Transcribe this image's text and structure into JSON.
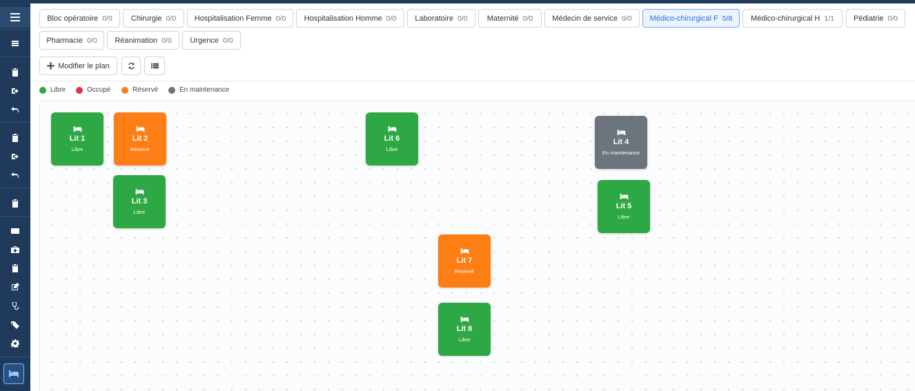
{
  "tabs": [
    {
      "label": "Bloc opératoire",
      "count": "0/0"
    },
    {
      "label": "Chirurgie",
      "count": "0/0"
    },
    {
      "label": "Hospitalisation Femme",
      "count": "0/0"
    },
    {
      "label": "Hospitalisation Homme",
      "count": "0/0"
    },
    {
      "label": "Laboratoire",
      "count": "0/0"
    },
    {
      "label": "Maternité",
      "count": "0/0"
    },
    {
      "label": "Médecin de service",
      "count": "0/0"
    },
    {
      "label": "Médico-chirurgical F",
      "count": "5/8",
      "active": true
    },
    {
      "label": "Médico-chirurgical H",
      "count": "1/1"
    },
    {
      "label": "Pédiatrie",
      "count": "0/0"
    },
    {
      "label": "Pharmacie",
      "count": "0/0"
    },
    {
      "label": "Réanimation",
      "count": "0/0"
    },
    {
      "label": "Urgence",
      "count": "0/0"
    }
  ],
  "toolbar": {
    "edit_plan_label": "Modifier le plan",
    "edit_plan_icon": "move-icon",
    "refresh_icon": "refresh-icon",
    "list_icon": "list-icon"
  },
  "legend": [
    {
      "label": "Libre",
      "color": "#2ea844"
    },
    {
      "label": "Occupé",
      "color": "#dc3545"
    },
    {
      "label": "Réservé",
      "color": "#fd7e14"
    },
    {
      "label": "En maintenance",
      "color": "#6c757d"
    }
  ],
  "beds": [
    {
      "name": "Lit 1",
      "status": "Libre"
    },
    {
      "name": "Lit 2",
      "status": "Réservé"
    },
    {
      "name": "Lit 3",
      "status": "Libre"
    },
    {
      "name": "Lit 6",
      "status": "Libre"
    },
    {
      "name": "Lit 4",
      "status": "En maintenance"
    },
    {
      "name": "Lit 5",
      "status": "Libre"
    },
    {
      "name": "Lit 7",
      "status": "Réservé"
    },
    {
      "name": "Lit 8",
      "status": "Libre"
    }
  ],
  "colors": {
    "sidebar": "#1f3a5a",
    "libre": "#2ea844",
    "occupe": "#dc3545",
    "reserve": "#fd7e14",
    "maintenance": "#6c757d",
    "accent": "#2a6fd6"
  }
}
